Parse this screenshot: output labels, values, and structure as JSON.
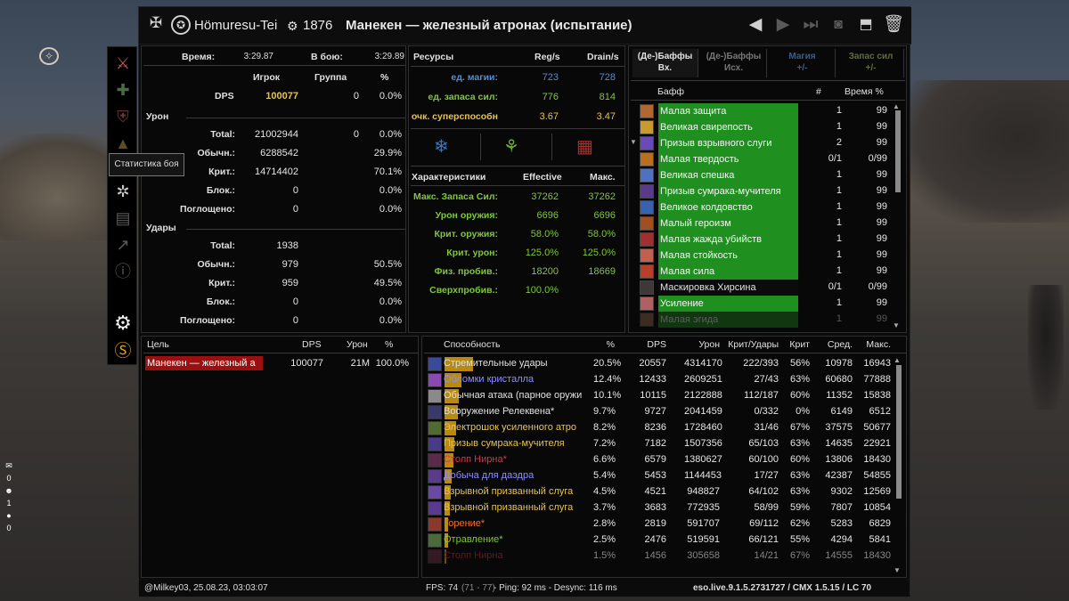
{
  "title": {
    "player": "Hömuresu-Tei",
    "cp": "1876",
    "encounter": "Манекен — железный атронах (испытание)"
  },
  "tooltip": "Статистика боя",
  "hud": {
    "counts": [
      "0",
      "1",
      "0"
    ]
  },
  "stats": {
    "time_label": "Время:",
    "time_value": "3:29.87",
    "incombat_label": "В бою:",
    "incombat_value": "3:29.89",
    "col_player": "Игрок",
    "col_group": "Группа",
    "col_pct": "%",
    "dps_label": "DPS",
    "dps_player": "100077",
    "dps_group": "0",
    "dps_pct": "0.0%",
    "damage_header": "Урон",
    "damage_rows": [
      {
        "label": "Total:",
        "player": "21002944",
        "group": "0",
        "pct": "0.0%"
      },
      {
        "label": "Обычн.:",
        "player": "6288542",
        "group": "",
        "pct": "29.9%"
      },
      {
        "label": "Крит.:",
        "player": "14714402",
        "group": "",
        "pct": "70.1%"
      },
      {
        "label": "Блок.:",
        "player": "0",
        "group": "",
        "pct": "0.0%"
      },
      {
        "label": "Поглощено:",
        "player": "0",
        "group": "",
        "pct": "0.0%"
      }
    ],
    "hits_header": "Удары",
    "hits_rows": [
      {
        "label": "Total:",
        "player": "1938",
        "pct": ""
      },
      {
        "label": "Обычн.:",
        "player": "979",
        "pct": "50.5%"
      },
      {
        "label": "Крит.:",
        "player": "959",
        "pct": "49.5%"
      },
      {
        "label": "Блок.:",
        "player": "0",
        "pct": "0.0%"
      },
      {
        "label": "Поглощено:",
        "player": "0",
        "pct": "0.0%"
      }
    ]
  },
  "resources": {
    "col_name": "Ресурсы",
    "col_reg": "Reg/s",
    "col_drain": "Drain/s",
    "rows": [
      {
        "label": "ед. магии:",
        "reg": "723",
        "drain": "728"
      },
      {
        "label": "ед. запаса сил:",
        "reg": "776",
        "drain": "814"
      },
      {
        "label": "очк. суперспособн",
        "reg": "3.67",
        "drain": "3.47"
      }
    ]
  },
  "characteristics": {
    "col_name": "Характеристики",
    "col_eff": "Effective",
    "col_max": "Макс.",
    "rows": [
      {
        "label": "Макс. Запаса Сил:",
        "eff": "37262",
        "max": "37262"
      },
      {
        "label": "Урон оружия:",
        "eff": "6696",
        "max": "6696"
      },
      {
        "label": "Крит. оружия:",
        "eff": "58.0%",
        "max": "58.0%"
      },
      {
        "label": "Крит. урон:",
        "eff": "125.0%",
        "max": "125.0%"
      },
      {
        "label": "Физ. пробив.:",
        "eff": "18200",
        "max": "18669"
      },
      {
        "label": "Сверхпробив.:",
        "eff": "100.0%",
        "max": ""
      }
    ]
  },
  "buffs": {
    "tabs": [
      {
        "l1": "(Де-)Баффы",
        "l2": "Вх."
      },
      {
        "l1": "(Де-)Баффы",
        "l2": "Исх."
      },
      {
        "l1": "Магия",
        "l2": "+/-"
      },
      {
        "l1": "Запас сил",
        "l2": "+/-"
      }
    ],
    "col_buff": "Бафф",
    "col_count": "#",
    "col_time": "Время %",
    "rows": [
      {
        "name": "Малая защита",
        "count": "1",
        "time": "99",
        "green": true
      },
      {
        "name": "Великая свирепость",
        "count": "1",
        "time": "99",
        "green": true
      },
      {
        "name": "Призыв взрывного слуги",
        "count": "2",
        "time": "99",
        "green": true
      },
      {
        "name": "Малая твердость",
        "count": "0/1",
        "time": "0/99",
        "green": true
      },
      {
        "name": "Великая спешка",
        "count": "1",
        "time": "99",
        "green": true
      },
      {
        "name": "Призыв сумрака-мучителя",
        "count": "1",
        "time": "99",
        "green": true
      },
      {
        "name": "Великое колдовство",
        "count": "1",
        "time": "99",
        "green": true
      },
      {
        "name": "Малый героизм",
        "count": "1",
        "time": "99",
        "green": true
      },
      {
        "name": "Малая жажда убийств",
        "count": "1",
        "time": "99",
        "green": true
      },
      {
        "name": "Малая стойкость",
        "count": "1",
        "time": "99",
        "green": true
      },
      {
        "name": "Малая сила",
        "count": "1",
        "time": "99",
        "green": true
      },
      {
        "name": "Маскировка Хирсина",
        "count": "0/1",
        "time": "0/99",
        "green": false
      },
      {
        "name": "Усиление",
        "count": "1",
        "time": "99",
        "green": true
      },
      {
        "name": "Малая эгида",
        "count": "1",
        "time": "99",
        "green": true
      }
    ]
  },
  "targets": {
    "col_target": "Цель",
    "col_dps": "DPS",
    "col_dmg": "Урон",
    "col_pct": "%",
    "rows": [
      {
        "name": "Манекен — железный а",
        "dps": "100077",
        "dmg": "21M",
        "pct": "100.0%"
      }
    ]
  },
  "abilities": {
    "cols": [
      "Способность",
      "%",
      "DPS",
      "Урон",
      "Крит/Удары",
      "Крит",
      "Сред.",
      "Макс."
    ],
    "rows": [
      {
        "name": "Стремительные удары",
        "pct": "20.5%",
        "dps": "20557",
        "dmg": "4314170",
        "crit_hits": "222/393",
        "crit": "56%",
        "avg": "10978",
        "max": "16943",
        "color": "#e0e0e0",
        "share": 0.205
      },
      {
        "name": "Обломки кристалла",
        "pct": "12.4%",
        "dps": "12433",
        "dmg": "2609251",
        "crit_hits": "27/43",
        "crit": "63%",
        "avg": "60680",
        "max": "77888",
        "color": "#8f8fff",
        "share": 0.124
      },
      {
        "name": "Обычная атака (парное оружи",
        "pct": "10.1%",
        "dps": "10115",
        "dmg": "2122888",
        "crit_hits": "112/187",
        "crit": "60%",
        "avg": "11352",
        "max": "15838",
        "color": "#e0e0e0",
        "share": 0.101
      },
      {
        "name": "Вооружение Релеквена*",
        "pct": "9.7%",
        "dps": "9727",
        "dmg": "2041459",
        "crit_hits": "0/332",
        "crit": "0%",
        "avg": "6149",
        "max": "6512",
        "color": "#e0e0e0",
        "share": 0.097
      },
      {
        "name": "Электрошок усиленного атро",
        "pct": "8.2%",
        "dps": "8236",
        "dmg": "1728460",
        "crit_hits": "31/46",
        "crit": "67%",
        "avg": "37575",
        "max": "50677",
        "color": "#e8c34a",
        "share": 0.082
      },
      {
        "name": "Призыв сумрака-мучителя",
        "pct": "7.2%",
        "dps": "7182",
        "dmg": "1507356",
        "crit_hits": "65/103",
        "crit": "63%",
        "avg": "14635",
        "max": "22921",
        "color": "#e8c34a",
        "share": 0.072
      },
      {
        "name": "Столп Нирна*",
        "pct": "6.6%",
        "dps": "6579",
        "dmg": "1380627",
        "crit_hits": "60/100",
        "crit": "60%",
        "avg": "13806",
        "max": "18430",
        "color": "#e0304a",
        "share": 0.066
      },
      {
        "name": "Добыча для даэдра",
        "pct": "5.4%",
        "dps": "5453",
        "dmg": "1144453",
        "crit_hits": "17/27",
        "crit": "63%",
        "avg": "42387",
        "max": "54855",
        "color": "#8f8fff",
        "share": 0.054
      },
      {
        "name": "Взрывной призванный слуга",
        "pct": "4.5%",
        "dps": "4521",
        "dmg": "948827",
        "crit_hits": "64/102",
        "crit": "63%",
        "avg": "9302",
        "max": "12569",
        "color": "#e8c34a",
        "share": 0.045
      },
      {
        "name": "Взрывной призванный слуга",
        "pct": "3.7%",
        "dps": "3683",
        "dmg": "772935",
        "crit_hits": "58/99",
        "crit": "59%",
        "avg": "7807",
        "max": "10854",
        "color": "#e8c34a",
        "share": 0.037
      },
      {
        "name": "Горение*",
        "pct": "2.8%",
        "dps": "2819",
        "dmg": "591707",
        "crit_hits": "69/112",
        "crit": "62%",
        "avg": "5283",
        "max": "6829",
        "color": "#f07030",
        "share": 0.028
      },
      {
        "name": "Отравление*",
        "pct": "2.5%",
        "dps": "2476",
        "dmg": "519591",
        "crit_hits": "66/121",
        "crit": "55%",
        "avg": "4294",
        "max": "5841",
        "color": "#7ec83a",
        "share": 0.025
      },
      {
        "name": "Столп Нирна",
        "pct": "1.5%",
        "dps": "1456",
        "dmg": "305658",
        "crit_hits": "14/21",
        "crit": "67%",
        "avg": "14555",
        "max": "18430",
        "color": "#a02838",
        "share": 0.015
      }
    ]
  },
  "status": {
    "left": "@Milkey03, 25.08.23, 03:03:07",
    "fps_label": "FPS:",
    "fps": "74",
    "fps_range": "(71 - 77)",
    "ping": "- Ping: 92 ms - Desync: 116 ms",
    "version": "eso.live.9.1.5.2731727 / CMX 1.5.15 / LC 70"
  }
}
